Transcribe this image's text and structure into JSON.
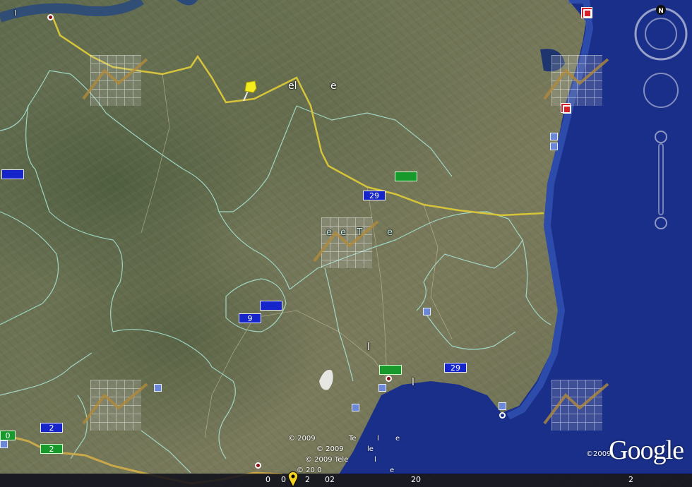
{
  "map": {
    "top_left_label": "l",
    "place_labels": [
      "el",
      "e",
      "e",
      "e",
      "T",
      "e",
      "l",
      "l"
    ],
    "road_shields": {
      "blue_29_a": "29",
      "blue_29_b": "29",
      "blue_9": "9",
      "blue_2": "2",
      "left_0": "0",
      "green_2": "2"
    },
    "bottom_labels": {
      "copy1": "© 2009",
      "te1": "Te",
      "l1": "l",
      "e1": "e",
      "copy2": "© 2009",
      "le2": "le",
      "copy3": "© 2009 Tele",
      "l3": "l",
      "copy4": "© 20 0",
      "e4": "e"
    },
    "logo_copyright": "©2009",
    "logo": "Google",
    "compass_north": "N"
  },
  "statusbar": {
    "v1": "0",
    "v2": "0",
    "v3": "2",
    "v4": "02",
    "v5": "20",
    "v6": "2"
  },
  "colors": {
    "water": "#1a2f8a",
    "road_yellow": "#d6c53a",
    "border_line": "#a9e6d6",
    "shield_blue": "#1525c9",
    "shield_green": "#179a2b",
    "poi_red": "#d8202a"
  },
  "icons": [
    "placemark-pushpin-icon",
    "poi-square-icon",
    "red-poi-icon",
    "city-dot-icon",
    "compass-icon",
    "look-joystick-icon",
    "zoom-slider-icon",
    "stats-tile-icon",
    "location-pin-icon"
  ]
}
